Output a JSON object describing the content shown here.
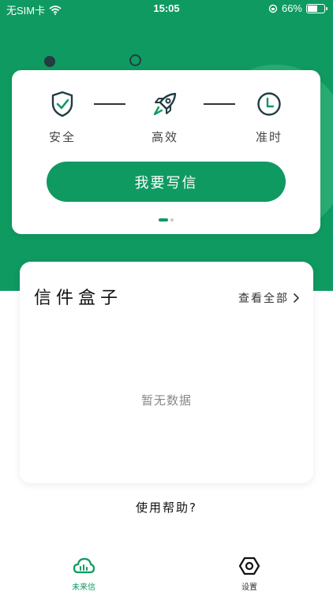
{
  "status_bar": {
    "carrier": "无SIM卡",
    "time": "15:05",
    "battery": "66%",
    "battery_level": 0.66
  },
  "features": [
    {
      "label": "安全",
      "icon": "shield-check-icon"
    },
    {
      "label": "高效",
      "icon": "rocket-icon"
    },
    {
      "label": "准时",
      "icon": "clock-icon"
    }
  ],
  "write_button": "我要写信",
  "carousel": {
    "page_count": 2,
    "active_index": 0
  },
  "mailbox": {
    "title": "信件盒子",
    "view_all": "查看全部",
    "empty_text": "暂无数据"
  },
  "help_link": "使用帮助?",
  "tabs": [
    {
      "label": "未来信",
      "icon": "cloud-chart-icon",
      "active": true
    },
    {
      "label": "设置",
      "icon": "settings-hex-icon",
      "active": false
    }
  ],
  "colors": {
    "brand_green": "#0f9a61",
    "dark": "#233b43",
    "muted": "#888888"
  }
}
